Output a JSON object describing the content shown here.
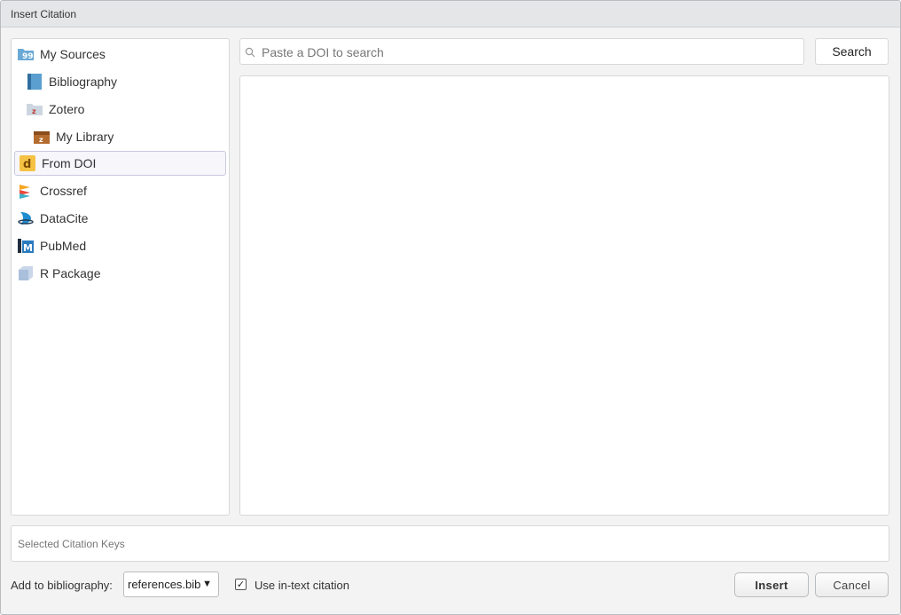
{
  "dialog": {
    "title": "Insert Citation"
  },
  "sidebar": {
    "items": [
      {
        "label": "My Sources",
        "icon": "quote-folder-icon"
      },
      {
        "label": "Bibliography",
        "icon": "book-icon"
      },
      {
        "label": "Zotero",
        "icon": "zotero-folder-icon"
      },
      {
        "label": "My Library",
        "icon": "zotero-library-icon"
      },
      {
        "label": "From DOI",
        "icon": "doi-icon",
        "selected": true
      },
      {
        "label": "Crossref",
        "icon": "crossref-icon"
      },
      {
        "label": "DataCite",
        "icon": "datacite-icon"
      },
      {
        "label": "PubMed",
        "icon": "pubmed-icon"
      },
      {
        "label": "R Package",
        "icon": "r-package-icon"
      }
    ]
  },
  "search": {
    "placeholder": "Paste a DOI to search",
    "value": "",
    "button_label": "Search"
  },
  "citation_keys": {
    "placeholder": "Selected Citation Keys"
  },
  "footer": {
    "bibliography_label": "Add to bibliography:",
    "bibliography_value": "references.bib",
    "bibliography_arrow": "▼",
    "in_text_label": "Use in-text citation",
    "in_text_checked": true,
    "check_mark": "✓",
    "insert_label": "Insert",
    "cancel_label": "Cancel"
  },
  "colors": {
    "doi_yellow": "#f5c244",
    "selection_border": "#c9c9e0",
    "datacite_blue": "#1e8dcf"
  }
}
